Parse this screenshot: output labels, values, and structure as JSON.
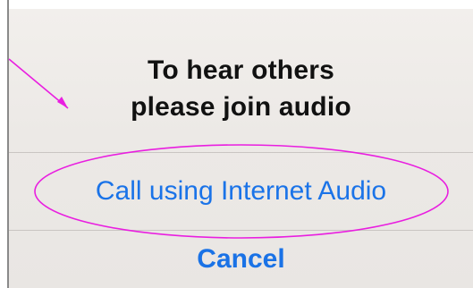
{
  "dialog": {
    "title_line1": "To hear others",
    "title_line2": "please join audio",
    "primary_action": "Call using Internet Audio",
    "cancel_action": "Cancel"
  },
  "annotation": {
    "color": "#e91ee0",
    "shapes": [
      "ellipse-highlight",
      "arrow-pointer"
    ]
  },
  "colors": {
    "action_blue": "#1a73e8",
    "title_text": "#111111",
    "divider": "#c9c5c2"
  }
}
